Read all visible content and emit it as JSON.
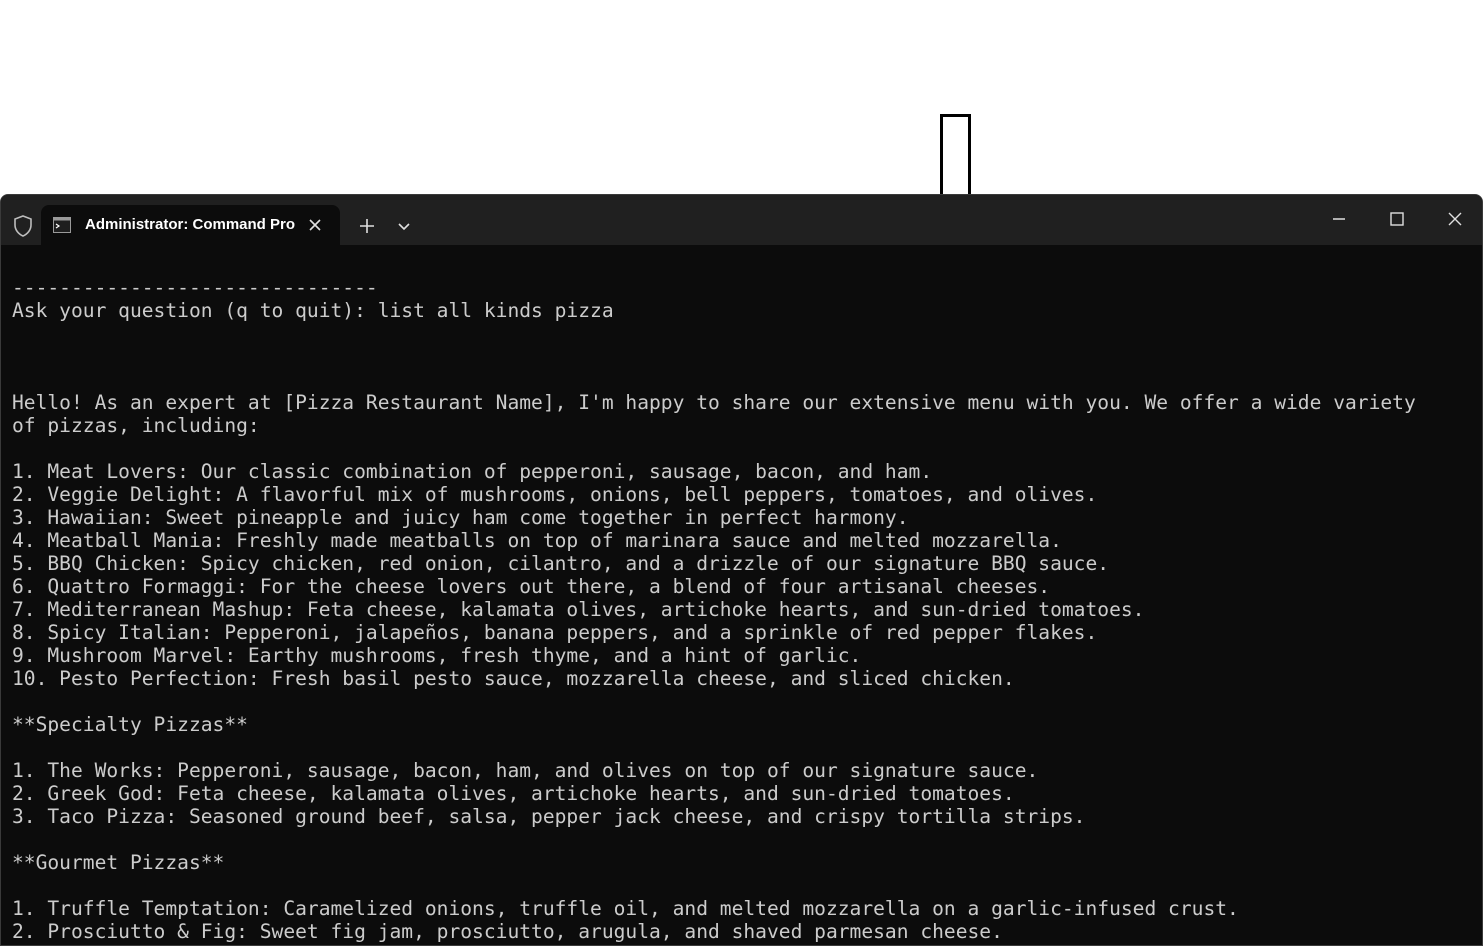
{
  "window": {
    "tab_title": "Administrator: Command Pro",
    "icons": {
      "shield": "shield-icon",
      "tab": "terminal-icon",
      "tab_close": "close-icon",
      "new_tab": "plus-icon",
      "dropdown": "chevron-down-icon",
      "minimize": "minimize-icon",
      "maximize": "maximize-icon",
      "close": "close-icon"
    },
    "colors": {
      "terminal_bg": "#0c0c0c",
      "titlebar_bg": "#202020",
      "text": "#cccccc"
    }
  },
  "terminal": {
    "lines": [
      "-------------------------------",
      "Ask your question (q to quit): list all kinds pizza",
      "",
      "",
      "",
      "Hello! As an expert at [Pizza Restaurant Name], I'm happy to share our extensive menu with you. We offer a wide variety",
      "of pizzas, including:",
      "",
      "1. Meat Lovers: Our classic combination of pepperoni, sausage, bacon, and ham.",
      "2. Veggie Delight: A flavorful mix of mushrooms, onions, bell peppers, tomatoes, and olives.",
      "3. Hawaiian: Sweet pineapple and juicy ham come together in perfect harmony.",
      "4. Meatball Mania: Freshly made meatballs on top of marinara sauce and melted mozzarella.",
      "5. BBQ Chicken: Spicy chicken, red onion, cilantro, and a drizzle of our signature BBQ sauce.",
      "6. Quattro Formaggi: For the cheese lovers out there, a blend of four artisanal cheeses.",
      "7. Mediterranean Mashup: Feta cheese, kalamata olives, artichoke hearts, and sun-dried tomatoes.",
      "8. Spicy Italian: Pepperoni, jalapeños, banana peppers, and a sprinkle of red pepper flakes.",
      "9. Mushroom Marvel: Earthy mushrooms, fresh thyme, and a hint of garlic.",
      "10. Pesto Perfection: Fresh basil pesto sauce, mozzarella cheese, and sliced chicken.",
      "",
      "**Specialty Pizzas**",
      "",
      "1. The Works: Pepperoni, sausage, bacon, ham, and olives on top of our signature sauce.",
      "2. Greek God: Feta cheese, kalamata olives, artichoke hearts, and sun-dried tomatoes.",
      "3. Taco Pizza: Seasoned ground beef, salsa, pepper jack cheese, and crispy tortilla strips.",
      "",
      "**Gourmet Pizzas**",
      "",
      "1. Truffle Temptation: Caramelized onions, truffle oil, and melted mozzarella on a garlic-infused crust.",
      "2. Prosciutto & Fig: Sweet fig jam, prosciutto, arugula, and shaved parmesan cheese."
    ]
  }
}
